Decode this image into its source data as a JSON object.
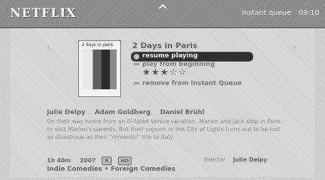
{
  "header": {
    "logo": "NETFLIX",
    "queue_label": "instant queue",
    "clock": "09:10"
  },
  "nav": {
    "left_arrow": "‹",
    "right_arrow": "›"
  },
  "movie": {
    "poster_title": "2 days in paris",
    "title": "2 Days in Paris",
    "menu": [
      {
        "label": "resume playing"
      },
      {
        "label": "play from beginning"
      },
      {
        "label": "remove from instant Queue"
      }
    ],
    "rating_stars": "★★★☆☆",
    "cast": [
      "Julie Delpy",
      "Adam Goldberg",
      "Daniel Brühl"
    ],
    "synopsis": "On their way home from an ill-fated Venice vacation, Marion and Jack stop in Paris to visit Marion's parents. But their sojourn in the City of Lights turns out to be just as disastrous as their \"romantic\" trip to Italy.",
    "runtime": "1h 40m",
    "year": "2007",
    "badge_rating": "R",
    "badge_hd": "HD",
    "director_label": "director",
    "director": "Julie Delpy",
    "genres": "Indie Comedies • Foreign Comedies"
  }
}
